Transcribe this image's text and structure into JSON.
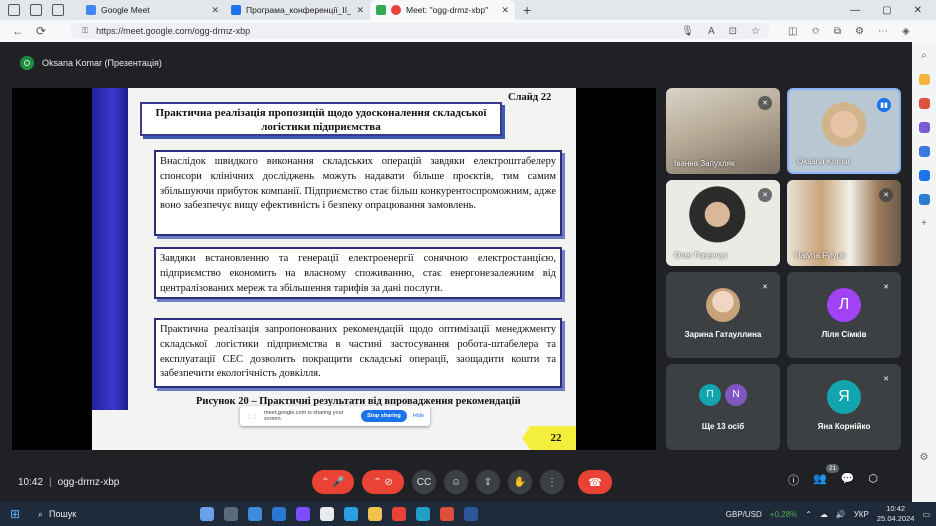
{
  "browser": {
    "tabs": [
      {
        "title": "Google Meet",
        "color": "#4285f4",
        "active": false
      },
      {
        "title": "Програма_конференції_II_етап",
        "color": "#1a73e8",
        "active": false
      },
      {
        "title": "Meet: \"ogg-drmz-xbp\"",
        "color": "#ea4335",
        "active": true
      }
    ],
    "url": "https://meet.google.com/ogg-drmz-xbp"
  },
  "meet": {
    "presenter_initial": "O",
    "presenter_label": "Oksana Komar (Презентація)",
    "slide": {
      "slide_no": "Слайд  22",
      "title": "Практична реалізація пропозицій щодо удосконалення складської логістики підприємства",
      "para1": "Внаслідок швидкого виконання складських операцій завдяки електроштабелеру спонсори клінічних досліджень можуть надавати більше проєктів, тим самим збільшуючи прибуток компанії. Підприємство стає більш конкурентоспроможним, адже воно забезпечує вищу ефективність і безпеку опрацювання замовлень.",
      "para2": "Завдяки встановленню та генерації електроенергії сонячною електростанцією, підприємство економить на власному споживанню, стає енергонезалежним від централізованих мереж та збільшення тарифів за дані послуги.",
      "para3": "Практична реалізація запропонованих рекомендацій щодо оптимізації менеджменту складської логістики підприємства в частині застосування робота-штабелера та експлуатації СЕС дозволить покращити складські операції, заощадити кошти та забезпечити екологічність довкілля.",
      "caption": "Рисунок 20 – Практичні результати від впровадження рекомендацій",
      "page_tag": "22"
    },
    "sharing_bar": {
      "text": "meet.google.com is sharing your screen.",
      "stop": "Stop sharing",
      "hide": "Hide"
    },
    "participants": [
      {
        "name": "Іванна Запухляк",
        "muted": true
      },
      {
        "name": "Oksana Komar",
        "speaking": true
      },
      {
        "name": "Олег Говенчук",
        "muted": true
      },
      {
        "name": "Halyna Fylyuk",
        "muted": true
      },
      {
        "name": "Зарина Гатауллина",
        "muted": true
      },
      {
        "name": "Ліля Сімків",
        "initial": "Л",
        "color": "#a142f4",
        "muted": true
      },
      {
        "name": "Ще 13 осіб",
        "initials": [
          "П",
          "N"
        ]
      },
      {
        "name": "Яна Корнійко",
        "initial": "Я",
        "color": "#12a4af",
        "muted": true
      }
    ],
    "time": "10:42",
    "meeting_code": "ogg-drmz-xbp",
    "people_count": "21"
  },
  "taskbar": {
    "search_placeholder": "Пошук",
    "ticker": "GBP/USD",
    "ticker_change": "+0,28%",
    "lang": "УКР",
    "time": "10:42",
    "date": "25.04.2024"
  }
}
